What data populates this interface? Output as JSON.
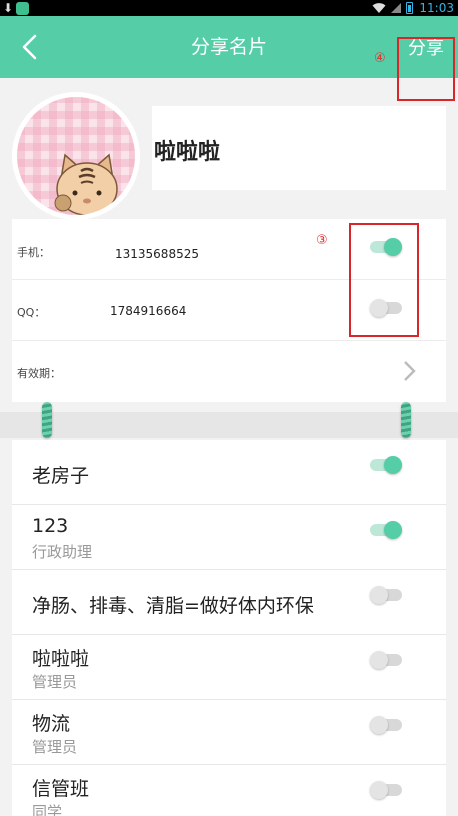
{
  "status_bar": {
    "time": "11:03"
  },
  "toolbar": {
    "title": "分享名片",
    "share_label": "分享",
    "annotation": "④"
  },
  "profile": {
    "name": "啦啦啦"
  },
  "info": {
    "annotation": "③",
    "rows": [
      {
        "label": "手机：",
        "value": "13135688525",
        "toggle": true
      },
      {
        "label": "QQ：",
        "value": "1784916664",
        "toggle": false
      },
      {
        "label": "有效期：",
        "value": ""
      }
    ]
  },
  "groups": [
    {
      "title": "老房子",
      "subtitle": "",
      "on": true
    },
    {
      "title": "123",
      "subtitle": "行政助理",
      "on": true
    },
    {
      "title": "净肠、排毒、清脂=做好体内环保",
      "subtitle": "",
      "on": false
    },
    {
      "title": "啦啦啦",
      "subtitle": "管理员",
      "on": false
    },
    {
      "title": "物流",
      "subtitle": "管理员",
      "on": false
    },
    {
      "title": "信管班",
      "subtitle": "同学",
      "on": false
    }
  ],
  "colors": {
    "primary": "#55cda6",
    "annotation": "#d9262b"
  }
}
